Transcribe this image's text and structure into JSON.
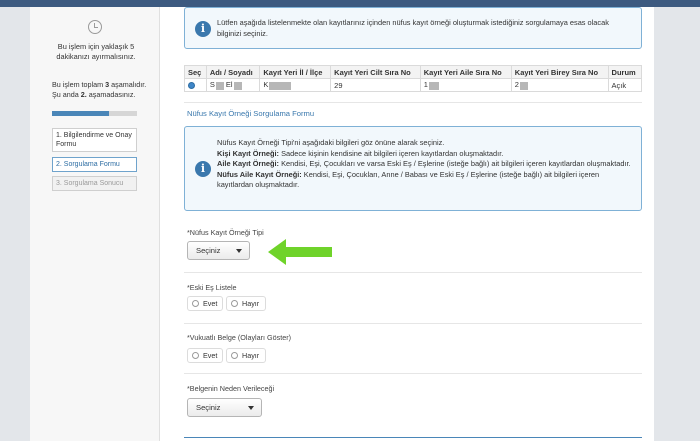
{
  "sidebar": {
    "time_note": "Bu işlem için yaklaşık 5 dakikanızı ayırmalısınız.",
    "steps_note": {
      "prefix": "Bu işlem toplam ",
      "total": "3",
      "middle": " aşamalıdır. Şu anda ",
      "current": "2.",
      "suffix": " aşamadasınız."
    },
    "progress_fraction": 0.67,
    "steps": [
      {
        "label": "1. Bilgilendirme ve Onay Formu",
        "state": "done"
      },
      {
        "label": "2. Sorgulama Formu",
        "state": "active"
      },
      {
        "label": "3. Sorgulama Sonucu",
        "state": "pending"
      }
    ]
  },
  "main": {
    "intro_info": "Lütfen aşağıda listelenmekte olan kayıtlarınız içinden nüfus kayıt örneği oluşturmak istediğiniz sorgulamaya esas olacak bilginizi seçiniz.",
    "table": {
      "headers": [
        "Seç",
        "Adı / Soyadı",
        "Kayıt Yeri İl / İlçe",
        "Kayıt Yeri Cilt Sıra No",
        "Kayıt Yeri Aile Sıra No",
        "Kayıt Yeri Birey Sıra No",
        "Durum"
      ],
      "row": {
        "name_first": "S",
        "name_last": "El",
        "place": "K",
        "cilt": "29",
        "aile": "1",
        "birey": "2",
        "status": "Açık"
      }
    },
    "form_title": "Nüfus Kayıt Örneği Sorgulama Formu",
    "types_info": {
      "intro": "Nüfus Kayıt Örneği Tipi'ni aşağıdaki bilgileri göz önüne alarak seçiniz.",
      "items": [
        {
          "term": "Kişi Kayıt Örneği:",
          "desc": " Sadece kişinin kendisine ait bilgileri içeren kayıtlardan oluşmaktadır."
        },
        {
          "term": "Aile Kayıt Örneği:",
          "desc": " Kendisi, Eşi, Çocukları ve varsa Eski Eş / Eşlerine (isteğe bağlı) ait bilgileri içeren kayıtlardan oluşmaktadır."
        },
        {
          "term": "Nüfus Aile Kayıt Örneği:",
          "desc": " Kendisi, Eşi, Çocukları, Anne / Babası ve Eski Eş / Eşlerine (isteğe bağlı) ait bilgileri içeren kayıtlardan oluşmaktadır."
        }
      ]
    },
    "fields": {
      "type_label": "*Nüfus Kayıt Örneği Tipi",
      "type_value": "Seçiniz",
      "ex_spouse_label": "*Eski Eş Listele",
      "ex_spouse_yes": "Evet",
      "ex_spouse_no": "Hayır",
      "events_label": "*Vukuatlı Belge (Olayları Göster)",
      "events_yes": "Evet",
      "events_no": "Hayır",
      "reason_label": "*Belgenin Neden Verileceği",
      "reason_value": "Seçiniz"
    }
  },
  "colors": {
    "accent": "#3a78ad",
    "info_border": "#7fb1d6",
    "arrow": "#6fd32a"
  },
  "icons": [
    "clock-icon",
    "info-icon",
    "chevron-down-icon",
    "green-arrow-icon"
  ]
}
